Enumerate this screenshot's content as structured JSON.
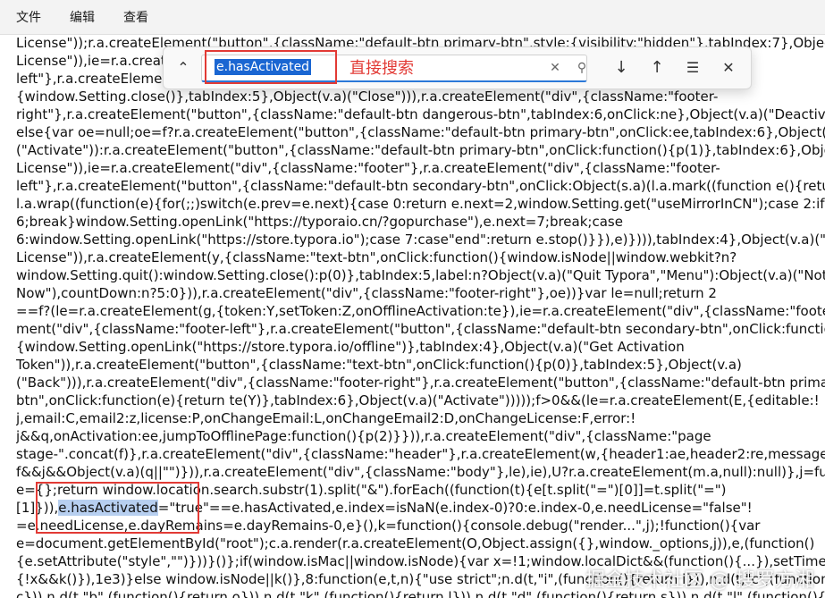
{
  "menubar": {
    "items": [
      "文件",
      "编辑",
      "查看"
    ]
  },
  "find": {
    "value": "e.hasActivated",
    "icons": {
      "collapse": "chevron-up-icon",
      "clear": "close-icon",
      "search": "search-icon",
      "next": "arrow-down-icon",
      "prev": "arrow-up-icon",
      "options": "options-icon",
      "close": "close-icon"
    }
  },
  "annotation": {
    "label": "直接搜索",
    "color": "#e23a35"
  },
  "code": {
    "lines": [
      {
        "parts": [
          {
            "t": "License\"));r.a.createElement(\"button\",{className:\"default-btn primary-btn\",style:{visibility:\"hidden\"},tabIndex:7},Object(v.a)("
          }
        ]
      },
      {
        "parts": [
          {
            "t": "License\")),ie=r.a.createE"
          }
        ]
      },
      {
        "parts": [
          {
            "t": "left\"},r.a.createElemen"
          }
        ]
      },
      {
        "parts": [
          {
            "t": "{window.Setting.close()},tabIndex:5},Object(v.a)(\"Close\"))),r.a.createElement(\"div\",{className:\"footer-"
          }
        ]
      },
      {
        "parts": [
          {
            "t": "right\"},r.a.createElement(\"button\",{className:\"default-btn dangerous-btn\",tabIndex:6,onClick:ne},Object(v.a)(\"Deactivate\")),"
          }
        ]
      },
      {
        "parts": [
          {
            "t": "else{var oe=null;oe=f?r.a.createElement(\"button\",{className:\"default-btn primary-btn\",onClick:ee,tabIndex:6},Object(v.a)"
          }
        ]
      },
      {
        "parts": [
          {
            "t": "(\"Activate\")):r.a.createElement(\"button\",{className:\"default-btn primary-btn\",onClick:function(){p(1)},tabIndex:6},Object(v.a)"
          }
        ]
      },
      {
        "parts": [
          {
            "t": "License\")),ie=r.a.createElement(\"div\",{className:\"footer\"},r.a.createElement(\"div\",{className:\"footer-"
          }
        ]
      },
      {
        "parts": [
          {
            "t": "left\"},r.a.createElement(\"button\",{className:\"default-btn secondary-btn\",onClick:Object(s.a)(l.a.mark((function e(){return"
          }
        ]
      },
      {
        "parts": [
          {
            "t": "l.a.wrap((function(e){for(;;)switch(e.prev=e.next){case 0:return e.next=2,window.Setting.get(\"useMirrorInCN\");case 2:if(!e.sent"
          }
        ]
      },
      {
        "parts": [
          {
            "t": "6;break}window.Setting.openLink(\"https://typoraio.cn/?gopurchase\"),e.next=7;break;case"
          }
        ]
      },
      {
        "parts": [
          {
            "t": "6:window.Setting.openLink(\"https://store.typora.io\");case 7:case\"end\":return e.stop()}}),e)}))),tabIndex:4},Object(v.a)(\"Buy"
          }
        ]
      },
      {
        "parts": [
          {
            "t": "License\")),r.a.createElement(y,{className:\"text-btn\",onClick:function(){window.isNode||window.webkit?n?"
          }
        ]
      },
      {
        "parts": [
          {
            "t": "window.Setting.quit():window.Setting.close():p(0)},tabIndex:5,label:n?Object(v.a)(\"Quit Typora\",\"Menu\"):Object(v.a)(\"Not"
          }
        ]
      },
      {
        "parts": [
          {
            "t": "Now\"),countDown:n?5:0})),r.a.createElement(\"div\",{className:\"footer-right\"},oe))}var le=null;return 2"
          }
        ]
      },
      {
        "parts": [
          {
            "t": "==f?(le=r.a.createElement(g,{token:Y,setToken:Z,onOfflineActivation:te}),ie=r.a.createElement(\"div\",{className:\"footer\"},r.a.c"
          }
        ]
      },
      {
        "parts": [
          {
            "t": "ment(\"div\",{className:\"footer-left\"},r.a.createElement(\"button\",{className:\"default-btn secondary-btn\",onClick:function()"
          }
        ]
      },
      {
        "parts": [
          {
            "t": "{window.Setting.openLink(\"https://store.typora.io/offline\")},tabIndex:4},Object(v.a)(\"Get Activation"
          }
        ]
      },
      {
        "parts": [
          {
            "t": "Token\")),r.a.createElement(\"button\",{className:\"text-btn\",onClick:function(){p(0)},tabIndex:5},Object(v.a)"
          }
        ]
      },
      {
        "parts": [
          {
            "t": "(\"Back\"))),r.a.createElement(\"div\",{className:\"footer-right\"},r.a.createElement(\"button\",{className:\"default-btn primary-"
          }
        ]
      },
      {
        "parts": [
          {
            "t": "btn\",onClick:function(e){return te(Y)},tabIndex:6},Object(v.a)(\"Activate\")))));f>0&&(le=r.a.createElement(E,{editable:!"
          }
        ]
      },
      {
        "parts": [
          {
            "t": "j,email:C,email2:z,license:P,onChangeEmail:L,onChangeEmail2:D,onChangeLicense:F,error:!"
          }
        ]
      },
      {
        "parts": [
          {
            "t": "j&&q,onActivation:ee,jumpToOfflinePage:function(){p(2)}})),r.a.createElement(\"div\",{className:\"page"
          }
        ]
      },
      {
        "parts": [
          {
            "t": "stage-\".concat(f)},r.a.createElement(\"div\",{className:\"header\"},r.a.createElement(w,{header1:ae,header2:re,message:!"
          }
        ]
      },
      {
        "parts": [
          {
            "t": "f&&j&&Object(v.a)(q||\"\")})),r.a.createElement(\"div\",{className:\"body\"},le),ie),U?r.a.createElement(m.a,null):null)},j=function(){va"
          }
        ]
      },
      {
        "parts": [
          {
            "t": "e={};return window.location.search.substr(1).split(\"&\").forEach((function(t){e[t.split(\"=\")[0]]=t.split(\"=\")"
          }
        ]
      },
      {
        "parts": [
          {
            "t": "[1]})),"
          },
          {
            "t": "e.hasActivated",
            "h": true
          },
          {
            "t": "=\"true\"==e.hasActivated,e.index=isNaN(e.index-0)?0:e.index-0,e.needLicense=\"false\"!"
          }
        ]
      },
      {
        "parts": [
          {
            "t": "=e.needLicense,e.dayRemains=e.dayRemains-0,e}(),k=function(){console.debug(\"render...\",j);!function(){var"
          }
        ]
      },
      {
        "parts": [
          {
            "t": "e=document.getElementById(\"root\");c.a.render(r.a.createElement(O,Object.assign({},window._options,j)),e,(function()"
          }
        ]
      },
      {
        "parts": [
          {
            "t": "{e.setAttribute(\"style\",\"\")}))}()};if(window.isMac||window.isNode){var x=!1;window.localDict&&(function(){...}),setTimeout(("
          }
        ]
      },
      {
        "parts": [
          {
            "t": "{!x&&k()}),1e3)}else window.isNode||k()},8:function(e,t,n){\"use strict\";n.d(t,\"i\",(function(){return i})),n.d(t,\"c\",(function(){return"
          }
        ]
      },
      {
        "parts": [
          {
            "t": "c})),n.d(t,\"b\",(function(){return o})),n.d(t,\"k\",(function(){return l})),n.d(t,\"d\",(function(){return s})),n.d(t,\"l\",(function(){return"
          }
        ]
      }
    ]
  },
  "watermark": "掘金技术社区 @ 搜罗方湘"
}
